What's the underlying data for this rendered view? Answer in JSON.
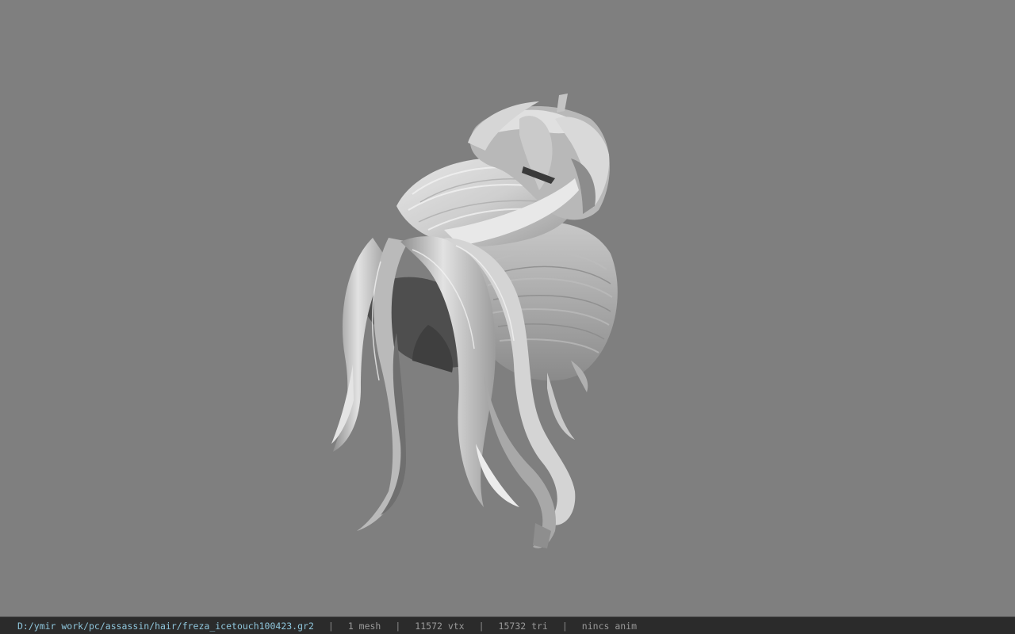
{
  "viewer": {
    "background": "#7f7f7f",
    "model": "hair-mesh"
  },
  "statusbar": {
    "file_path": "D:/ymir work/pc/assassin/hair/freza_icetouch100423.gr2",
    "separator": "|",
    "mesh_count": "1 mesh",
    "vertex_count": "11572 vtx",
    "triangle_count": "15732 tri",
    "anim_info": "nincs anim",
    "path_color": "#8fc6dc",
    "text_color": "#9a9a9a",
    "background": "#2b2b2b"
  }
}
